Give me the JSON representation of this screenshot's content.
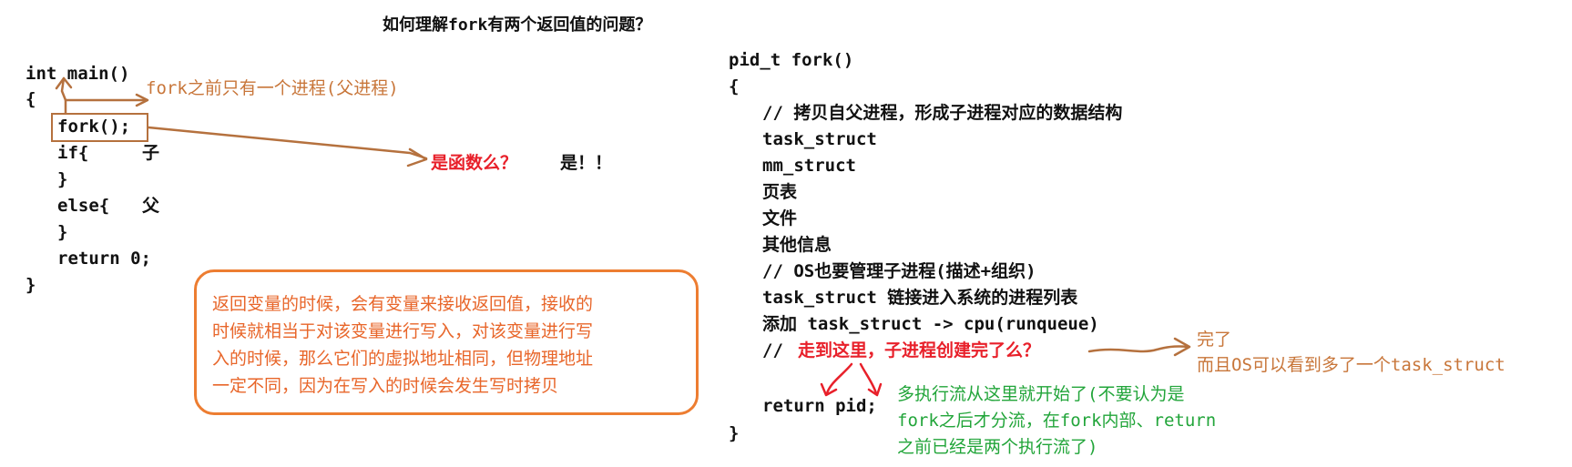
{
  "title": "如何理解fork有两个返回值的问题？",
  "left_code": [
    "int main()",
    "{",
    "fork();",
    "if{",
    "}",
    "else{",
    "}",
    "return 0;",
    "}"
  ],
  "left_comments": {
    "child": "子",
    "parent": "父"
  },
  "annotations": {
    "before_fork": "fork之前只有一个进程(父进程)",
    "is_function_q": "是函数么？",
    "is_function_a": "是！！"
  },
  "note_lines": [
    "返回变量的时候，会有变量来接收返回值，接收的",
    "时候就相当于对该变量进行写入，对该变量进行写",
    "入的时候，那么它们的虚拟地址相同，但物理地址",
    "一定不同，因为在写入的时候会发生写时拷贝"
  ],
  "right_code": [
    "pid_t fork()",
    "{",
    "// 拷贝自父进程，形成子进程对应的数据结构",
    "task_struct",
    "mm_struct",
    "页表",
    "文件",
    "其他信息",
    "// OS也要管理子进程(描述+组织)",
    "task_struct 链接进入系统的进程列表",
    "添加 task_struct -> cpu(runqueue)",
    "//",
    "return pid;",
    "}"
  ],
  "right_annotations": {
    "done_question": "走到这里，子进程创建完了么？",
    "done_answer_1": "完了",
    "done_answer_2": "而且OS可以看到多了一个task_struct",
    "multi_flow": [
      "多执行流从这里就开始了(不要认为是",
      "fork之后才分流，在fork内部、return",
      "之前已经是两个执行流了)"
    ]
  },
  "colors": {
    "code": "#111111",
    "orange_note": "#c8763a",
    "red": "#e8202a",
    "green": "#22a53a",
    "box_border": "#ed7d31"
  }
}
